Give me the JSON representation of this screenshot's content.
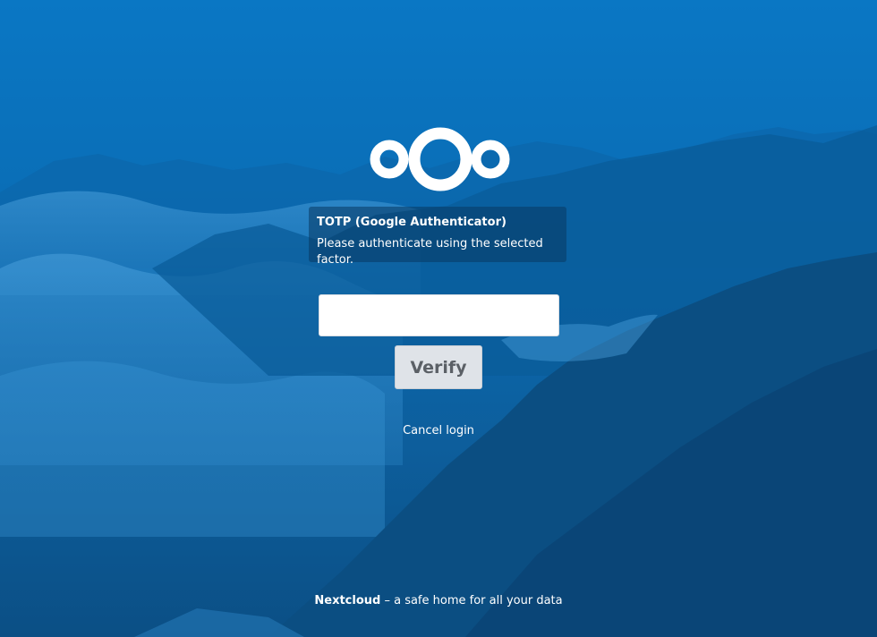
{
  "background": {
    "description_icon": "mountain-landscape-background",
    "base_color": "#0a6fb8"
  },
  "logo": {
    "icon": "nextcloud-logo-icon",
    "color": "#ffffff"
  },
  "notice": {
    "title": "TOTP (Google Authenticator)",
    "text": "Please authenticate using the selected factor."
  },
  "form": {
    "code_value": "",
    "code_placeholder": "",
    "verify_label": "Verify"
  },
  "cancel": {
    "label": "Cancel login"
  },
  "footer": {
    "brand": "Nextcloud",
    "tagline": " – a safe home for all your data"
  }
}
